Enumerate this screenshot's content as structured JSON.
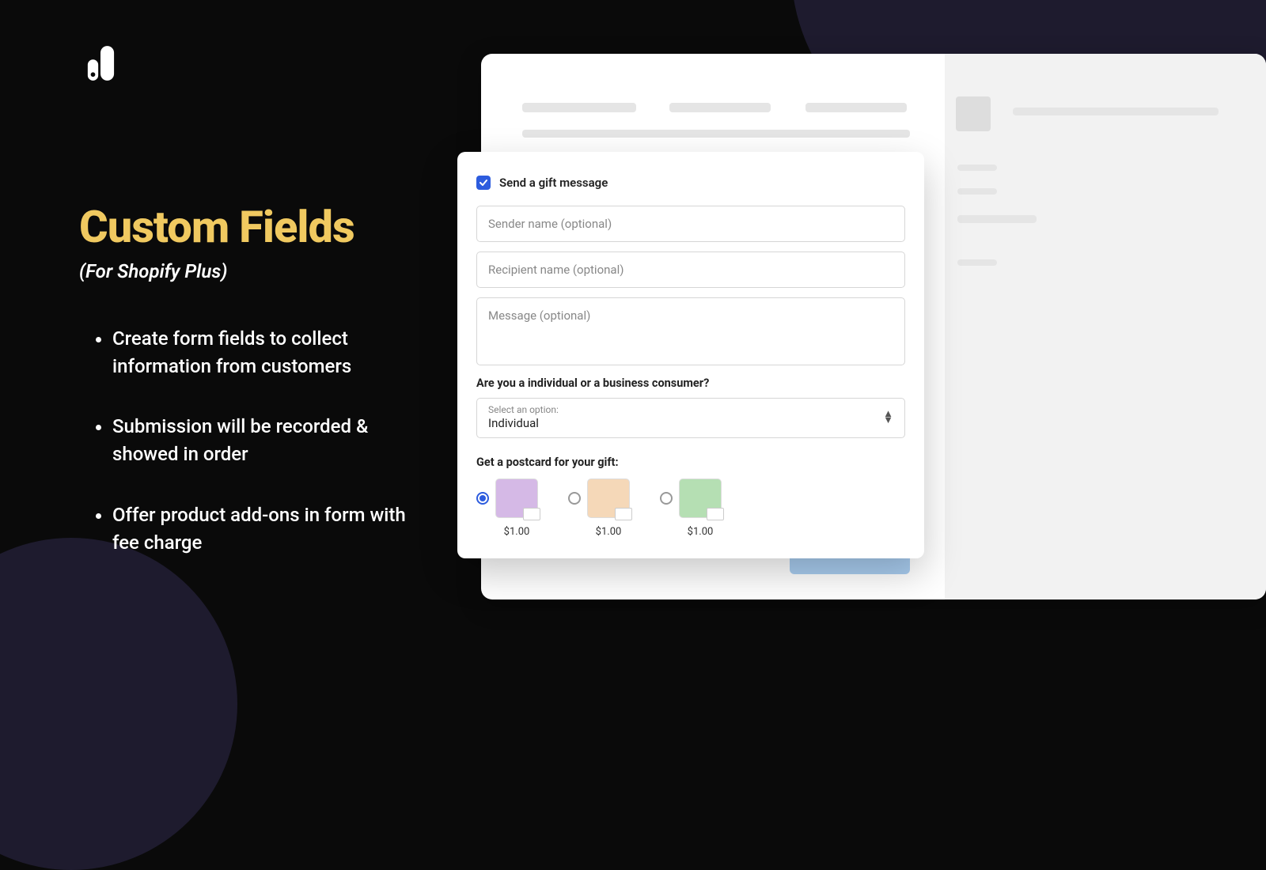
{
  "left": {
    "title": "Custom Fields",
    "subtitle": "(For Shopify Plus)",
    "bullets": [
      "Create form fields to collect information from customers",
      "Submission will be recorded & showed in order",
      "Offer product add-ons in form with fee charge"
    ]
  },
  "form": {
    "gift_checkbox_label": "Send a gift message",
    "gift_checked": true,
    "sender_placeholder": "Sender name (optional)",
    "recipient_placeholder": "Recipient name (optional)",
    "message_placeholder": "Message (optional)",
    "consumer_question": "Are you a individual or a business consumer?",
    "select_caption": "Select an option:",
    "select_value": "Individual",
    "postcard_label": "Get a postcard for your gift:",
    "postcards": [
      {
        "price": "$1.00",
        "bg": "#d5b9e6",
        "selected": true
      },
      {
        "price": "$1.00",
        "bg": "#f5d8b8",
        "selected": false
      },
      {
        "price": "$1.00",
        "bg": "#b5dfb3",
        "selected": false
      }
    ]
  }
}
